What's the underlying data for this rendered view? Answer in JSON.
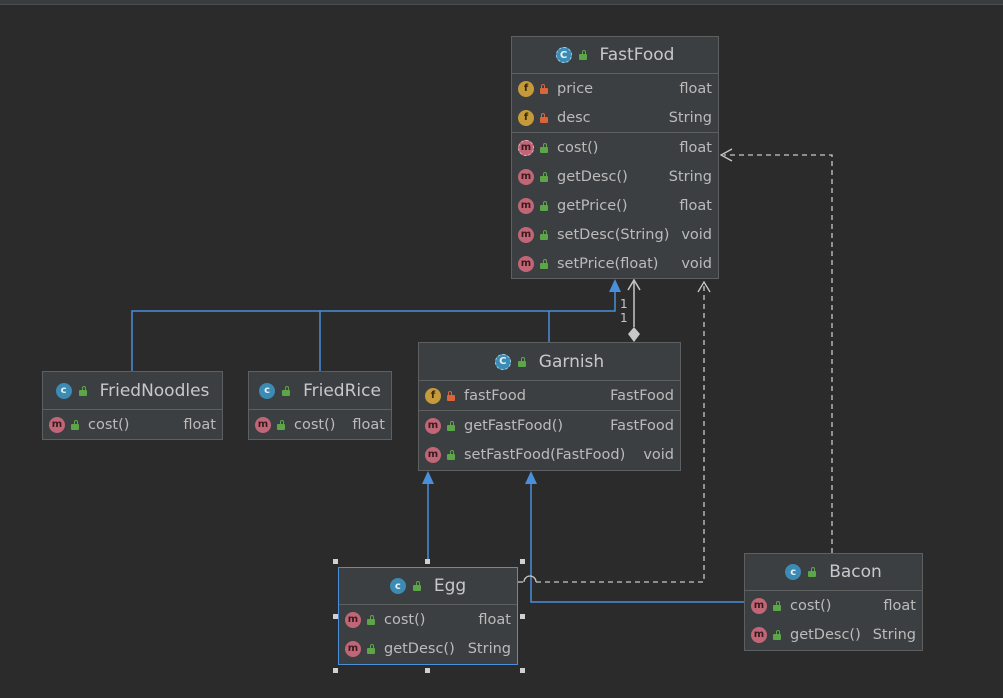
{
  "classes": {
    "fastfood": {
      "name": "FastFood",
      "fields": [
        {
          "name": "price",
          "type": "float"
        },
        {
          "name": "desc",
          "type": "String"
        }
      ],
      "methods": [
        {
          "name": "cost()",
          "type": "float"
        },
        {
          "name": "getDesc()",
          "type": "String"
        },
        {
          "name": "getPrice()",
          "type": "float"
        },
        {
          "name": "setDesc(String)",
          "type": "void"
        },
        {
          "name": "setPrice(float)",
          "type": "void"
        }
      ]
    },
    "friednoodles": {
      "name": "FriedNoodles",
      "methods": [
        {
          "name": "cost()",
          "type": "float"
        }
      ]
    },
    "friedrice": {
      "name": "FriedRice",
      "methods": [
        {
          "name": "cost()",
          "type": "float"
        }
      ]
    },
    "garnish": {
      "name": "Garnish",
      "fields": [
        {
          "name": "fastFood",
          "type": "FastFood"
        }
      ],
      "methods": [
        {
          "name": "getFastFood()",
          "type": "FastFood"
        },
        {
          "name": "setFastFood(FastFood)",
          "type": "void"
        }
      ]
    },
    "egg": {
      "name": "Egg",
      "methods": [
        {
          "name": "cost()",
          "type": "float"
        },
        {
          "name": "getDesc()",
          "type": "String"
        }
      ]
    },
    "bacon": {
      "name": "Bacon",
      "methods": [
        {
          "name": "cost()",
          "type": "float"
        },
        {
          "name": "getDesc()",
          "type": "String"
        }
      ]
    }
  },
  "multiplicity": {
    "upper": "1",
    "lower": "1"
  },
  "colors": {
    "background": "#2b2b2b",
    "inheritance_edge": "#4b8ed9",
    "dependency_edge": "#c8c8c8",
    "selection": "#4b8ed9"
  },
  "icons": {
    "abstract_class": "abstract-class-icon",
    "class": "class-icon",
    "field": "field-icon",
    "method": "method-icon",
    "abstract_method": "abstract-method-icon",
    "public": "public-lock-icon",
    "private": "private-lock-icon"
  }
}
